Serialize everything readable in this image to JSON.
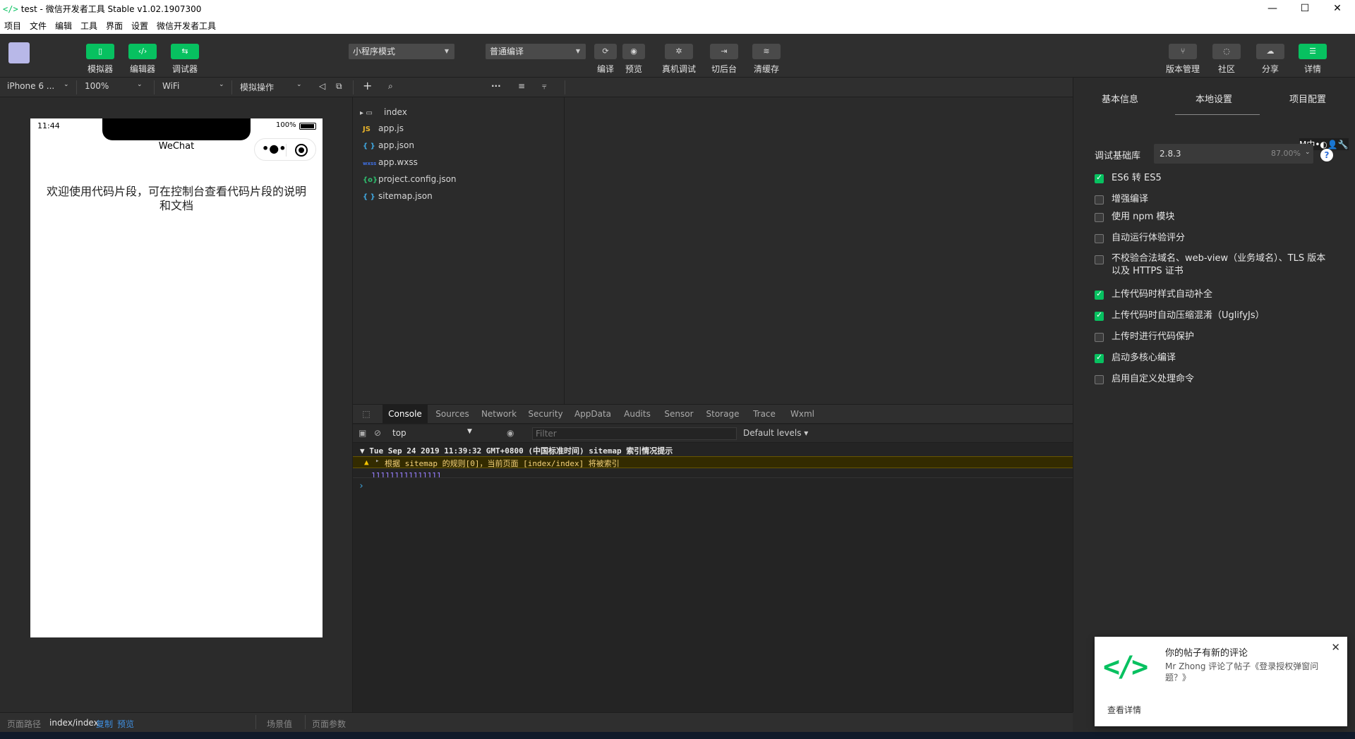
{
  "window": {
    "title": "test - 微信开发者工具 Stable v1.02.1907300",
    "title_icon": "</>",
    "minimize": "—",
    "maximize": "☐",
    "close": "✕"
  },
  "menu": [
    "项目",
    "文件",
    "编辑",
    "工具",
    "界面",
    "设置",
    "微信开发者工具"
  ],
  "toolbar": {
    "left_buttons": [
      {
        "label": "模拟器",
        "icon": "phone-icon",
        "glyph": "▯"
      },
      {
        "label": "编辑器",
        "icon": "code-icon",
        "glyph": "‹/›"
      },
      {
        "label": "调试器",
        "icon": "debug-icon",
        "glyph": "⇆"
      }
    ],
    "mode_select": "小程序模式",
    "compile_select": "普通编译",
    "center_buttons": [
      {
        "label": "编译",
        "icon": "refresh-icon",
        "glyph": "⟳"
      },
      {
        "label": "预览",
        "icon": "eye-icon",
        "glyph": "◉"
      },
      {
        "label": "真机调试",
        "icon": "bug-icon",
        "glyph": "✲"
      },
      {
        "label": "切后台",
        "icon": "switch-icon",
        "glyph": "⇥"
      },
      {
        "label": "清缓存",
        "icon": "layers-icon",
        "glyph": "≋"
      }
    ],
    "right_buttons": [
      {
        "label": "版本管理",
        "icon": "branch-icon",
        "glyph": "⑂"
      },
      {
        "label": "社区",
        "icon": "chat-icon",
        "glyph": "◌"
      },
      {
        "label": "分享",
        "icon": "cloud-icon",
        "glyph": "☁"
      },
      {
        "label": "详情",
        "icon": "menu-icon",
        "glyph": "☰"
      }
    ]
  },
  "subbar": {
    "device": "iPhone 6 ...",
    "zoom": "100%",
    "network": "WiFi",
    "operation": "模拟操作"
  },
  "simulator": {
    "time": "11:44",
    "battery_pct": "100%",
    "nav_title": "WeChat",
    "welcome_text": "欢迎使用代码片段，可在控制台查看代码片段的说明和文档"
  },
  "filetree": [
    {
      "name": "index",
      "type": "folder",
      "icon": "folder-icon",
      "glyph": "▸ ▭"
    },
    {
      "name": "app.js",
      "type": "js",
      "icon": "js-file-icon",
      "glyph": "JS"
    },
    {
      "name": "app.json",
      "type": "json",
      "icon": "json-file-icon",
      "glyph": "{ }"
    },
    {
      "name": "app.wxss",
      "type": "wxss",
      "icon": "wxss-file-icon",
      "glyph": "wxss"
    },
    {
      "name": "project.config.json",
      "type": "config",
      "icon": "config-file-icon",
      "glyph": "{o}"
    },
    {
      "name": "sitemap.json",
      "type": "json",
      "icon": "json-file-icon",
      "glyph": "{ }"
    }
  ],
  "devtools": {
    "tabs": [
      "Console",
      "Sources",
      "Network",
      "Security",
      "AppData",
      "Audits",
      "Sensor",
      "Storage",
      "Trace",
      "Wxml"
    ],
    "active_tab": "Console",
    "context": "top",
    "filter_placeholder": "Filter",
    "levels": "Default levels ▾",
    "log_group": "▼ Tue Sep 24 2019 11:39:32 GMT+0800 (中国标准时间) sitemap 索引情况提示",
    "warning": "根据 sitemap 的规则[0]，当前页面 [index/index] 将被索引",
    "log_value": "111111111111111",
    "prompt": "›"
  },
  "rightpanel": {
    "tabs": [
      "基本信息",
      "本地设置",
      "项目配置"
    ],
    "active_tab": "本地设置",
    "lib_label": "调试基础库",
    "lib_version": "2.8.3",
    "lib_percent": "87.00%",
    "help": "?",
    "ime_bar": "M中•◐👤🔧",
    "options": [
      {
        "label": "ES6 转 ES5",
        "checked": true
      },
      {
        "label": "增强编译",
        "checked": false
      },
      {
        "label": "使用 npm 模块",
        "checked": false
      },
      {
        "label": "自动运行体验评分",
        "checked": false
      },
      {
        "label": "不校验合法域名、web-view（业务域名）、TLS 版本以及 HTTPS 证书",
        "checked": false
      },
      {
        "label": "上传代码时样式自动补全",
        "checked": true
      },
      {
        "label": "上传代码时自动压缩混淆（UglifyJs）",
        "checked": true
      },
      {
        "label": "上传时进行代码保护",
        "checked": false
      },
      {
        "label": "启动多核心编译",
        "checked": true
      },
      {
        "label": "启用自定义处理命令",
        "checked": false
      }
    ]
  },
  "statusbar": {
    "path_label": "页面路径",
    "path": "index/index",
    "copy": "复制",
    "preview": "预览",
    "scene": "场景值",
    "params": "页面参数"
  },
  "notification": {
    "title": "你的帖子有新的评论",
    "body": "Mr Zhong 评论了帖子《登录授权弹窗问题？》",
    "link": "查看详情",
    "close": "✕",
    "logo": "</>"
  },
  "colors": {
    "accent": "#07c160",
    "warning_bg": "#332b00",
    "warning_text": "#f5d27a",
    "log_blue": "#9980ff"
  }
}
